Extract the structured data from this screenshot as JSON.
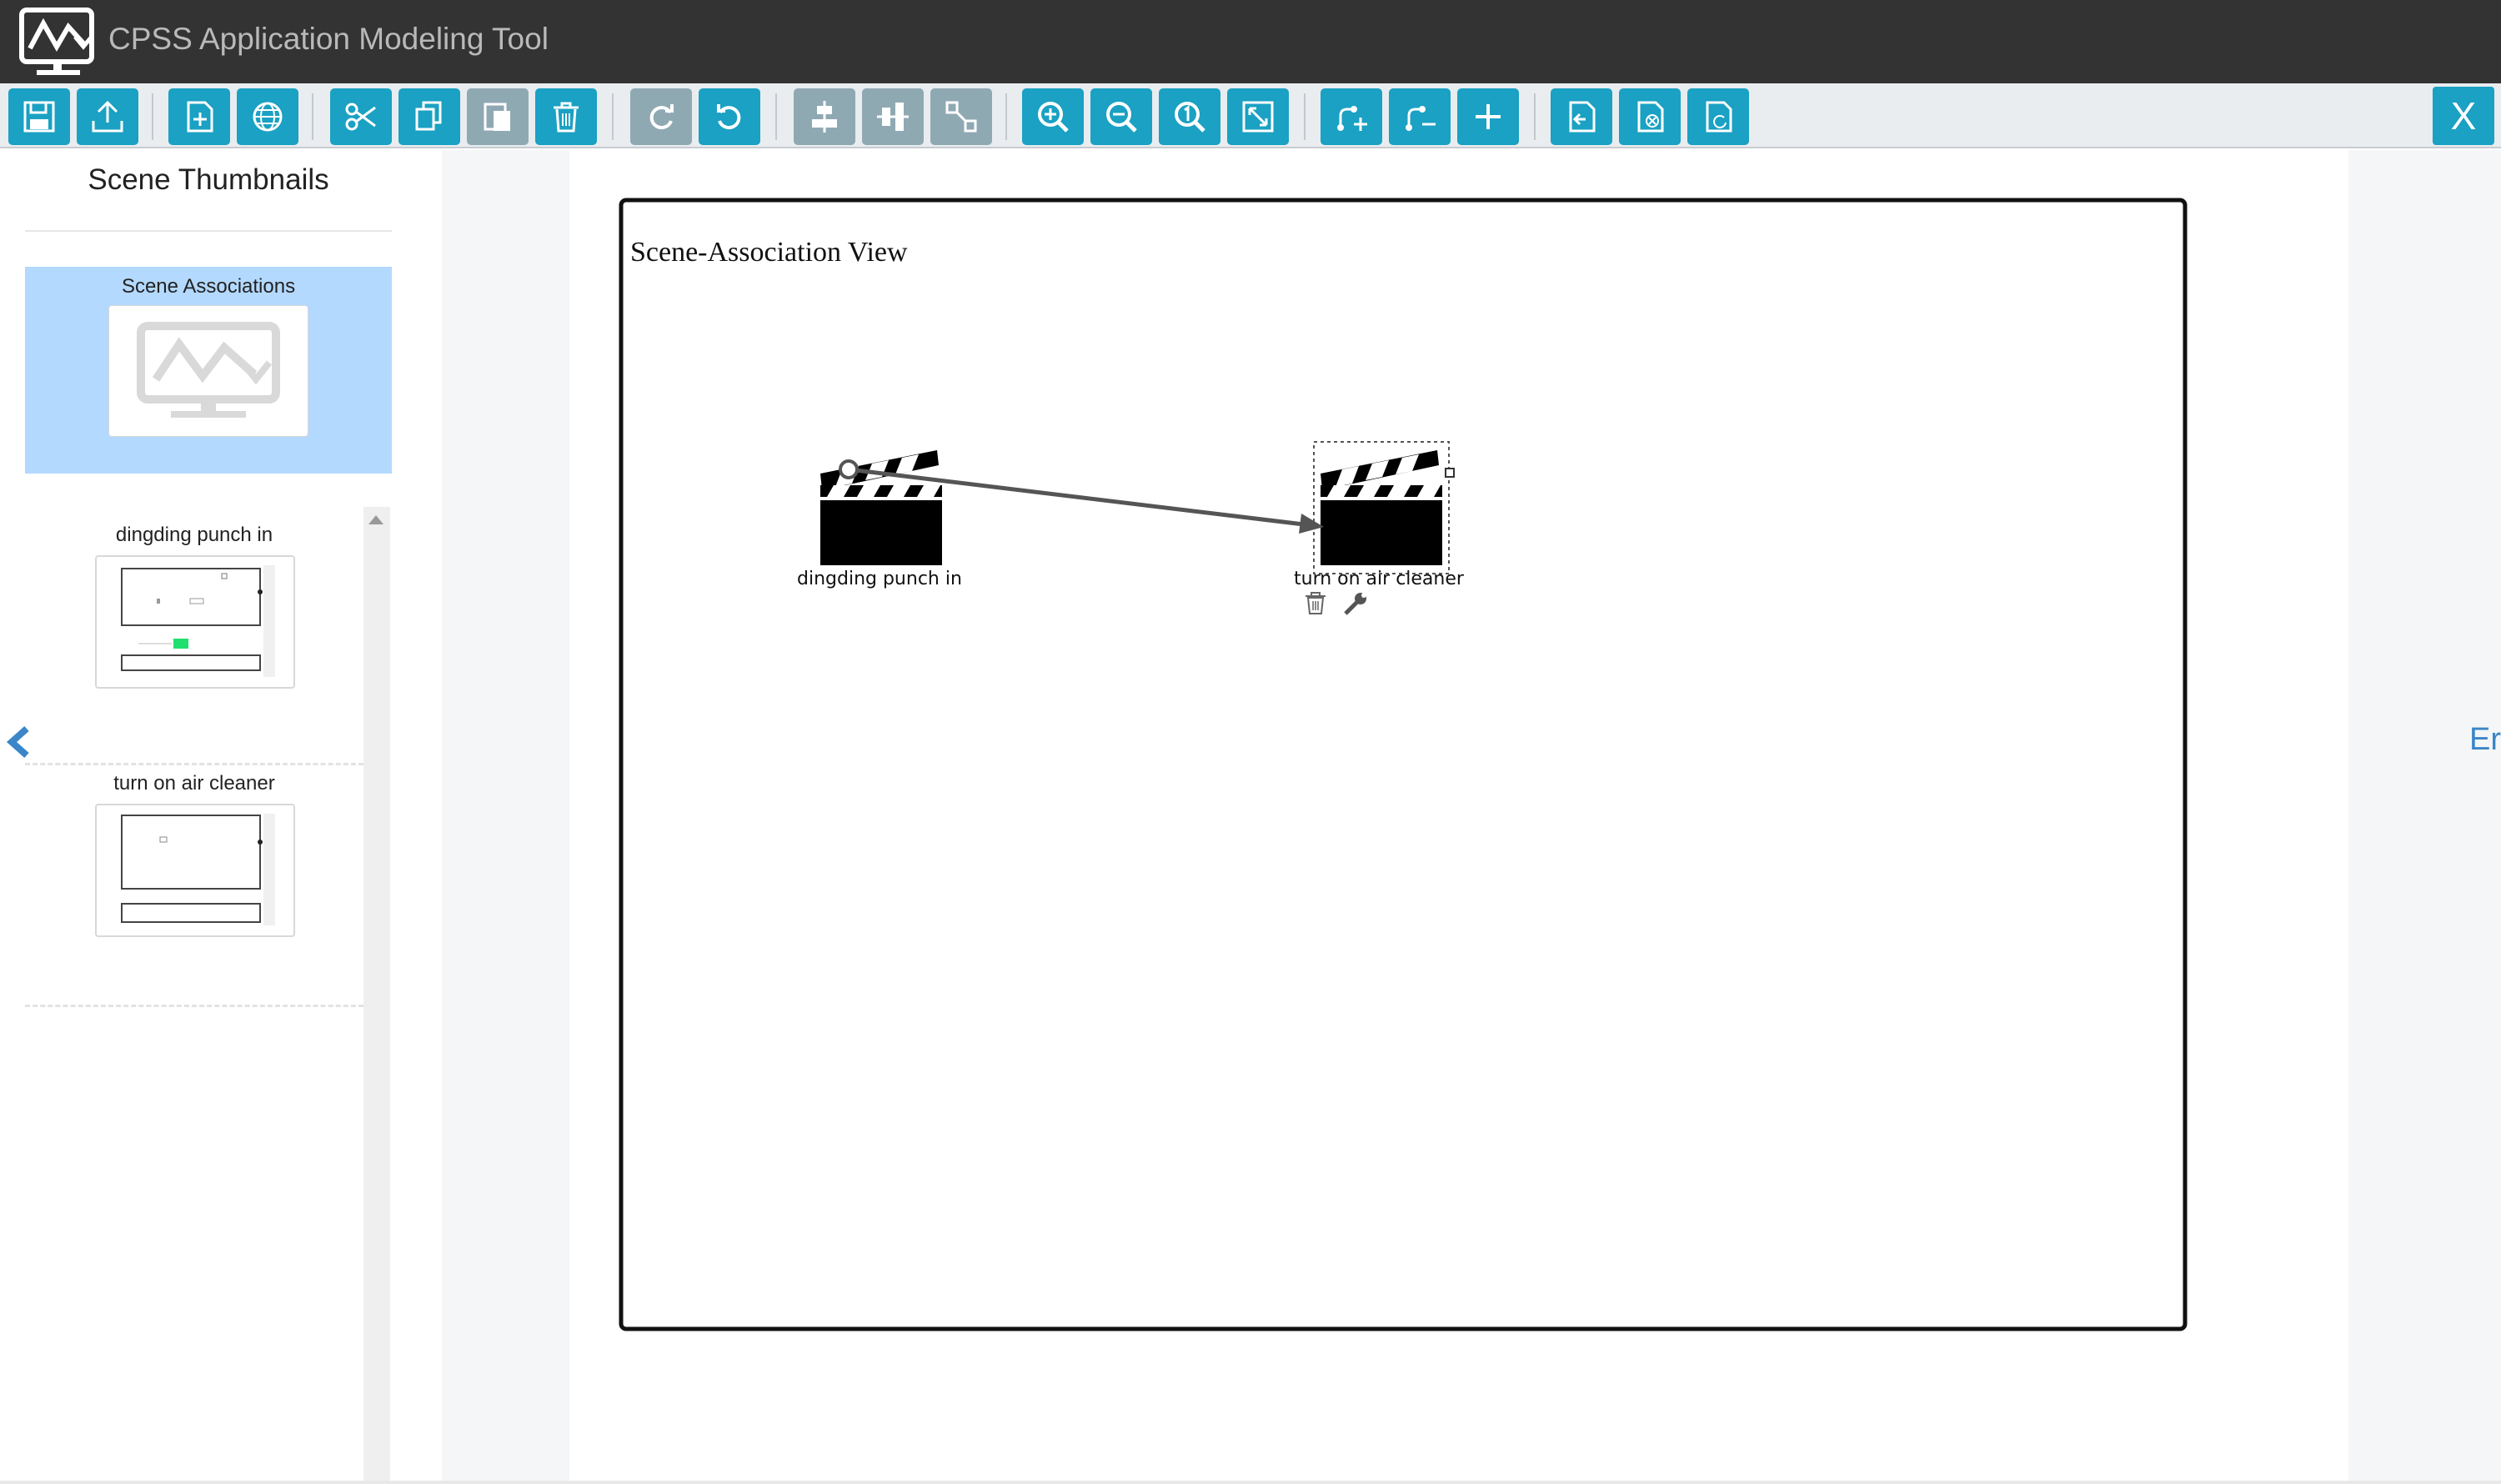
{
  "app": {
    "title": "CPSS Application Modeling Tool",
    "close_label": "X"
  },
  "toolbar": {
    "buttons": [
      {
        "name": "save-button",
        "icon": "save-icon"
      },
      {
        "name": "upload-button",
        "icon": "upload-icon"
      },
      {
        "name": "new-scene-button",
        "icon": "new-file-icon"
      },
      {
        "name": "globe-button",
        "icon": "globe-icon"
      },
      {
        "name": "cut-button",
        "icon": "scissors-icon"
      },
      {
        "name": "copy-button",
        "icon": "copy-icon"
      },
      {
        "name": "paste-button",
        "icon": "paste-icon"
      },
      {
        "name": "delete-button",
        "icon": "trash-icon"
      },
      {
        "name": "redo-button",
        "icon": "redo-icon"
      },
      {
        "name": "undo-button",
        "icon": "undo-icon"
      },
      {
        "name": "align-horizontal-button",
        "icon": "align-h-icon"
      },
      {
        "name": "align-vertical-button",
        "icon": "align-v-icon"
      },
      {
        "name": "fit-nodes-button",
        "icon": "expand-nodes-icon"
      },
      {
        "name": "zoom-in-button",
        "icon": "zoom-in-icon"
      },
      {
        "name": "zoom-out-button",
        "icon": "zoom-out-icon"
      },
      {
        "name": "zoom-actual-button",
        "icon": "zoom-one-icon"
      },
      {
        "name": "fit-window-button",
        "icon": "fit-icon"
      },
      {
        "name": "add-edge-button",
        "icon": "edge-add-icon"
      },
      {
        "name": "remove-edge-button",
        "icon": "edge-remove-icon"
      },
      {
        "name": "add-node-button",
        "icon": "plus-icon"
      },
      {
        "name": "import-button",
        "icon": "import-doc-icon"
      },
      {
        "name": "delete-doc-button",
        "icon": "delete-doc-icon"
      },
      {
        "name": "refresh-doc-button",
        "icon": "refresh-doc-icon"
      }
    ],
    "accent_color": "#1aa1c3",
    "disabled_color": "#8fa9b3"
  },
  "sidebar": {
    "title": "Scene Thumbnails",
    "associations_label": "Scene Associations",
    "scenes": [
      {
        "label": "dingding punch in"
      },
      {
        "label": "turn on air cleaner"
      }
    ]
  },
  "canvas": {
    "view_title": "Scene-Association View",
    "nodes": [
      {
        "label": "dingding punch in",
        "icon": "clapperboard-icon",
        "selected": false
      },
      {
        "label": "turn on air cleaner",
        "icon": "clapperboard-icon",
        "selected": true
      }
    ],
    "edges": [
      {
        "from": "dingding punch in",
        "to": "turn on air cleaner"
      }
    ],
    "right_cutoff_text": "Er"
  }
}
